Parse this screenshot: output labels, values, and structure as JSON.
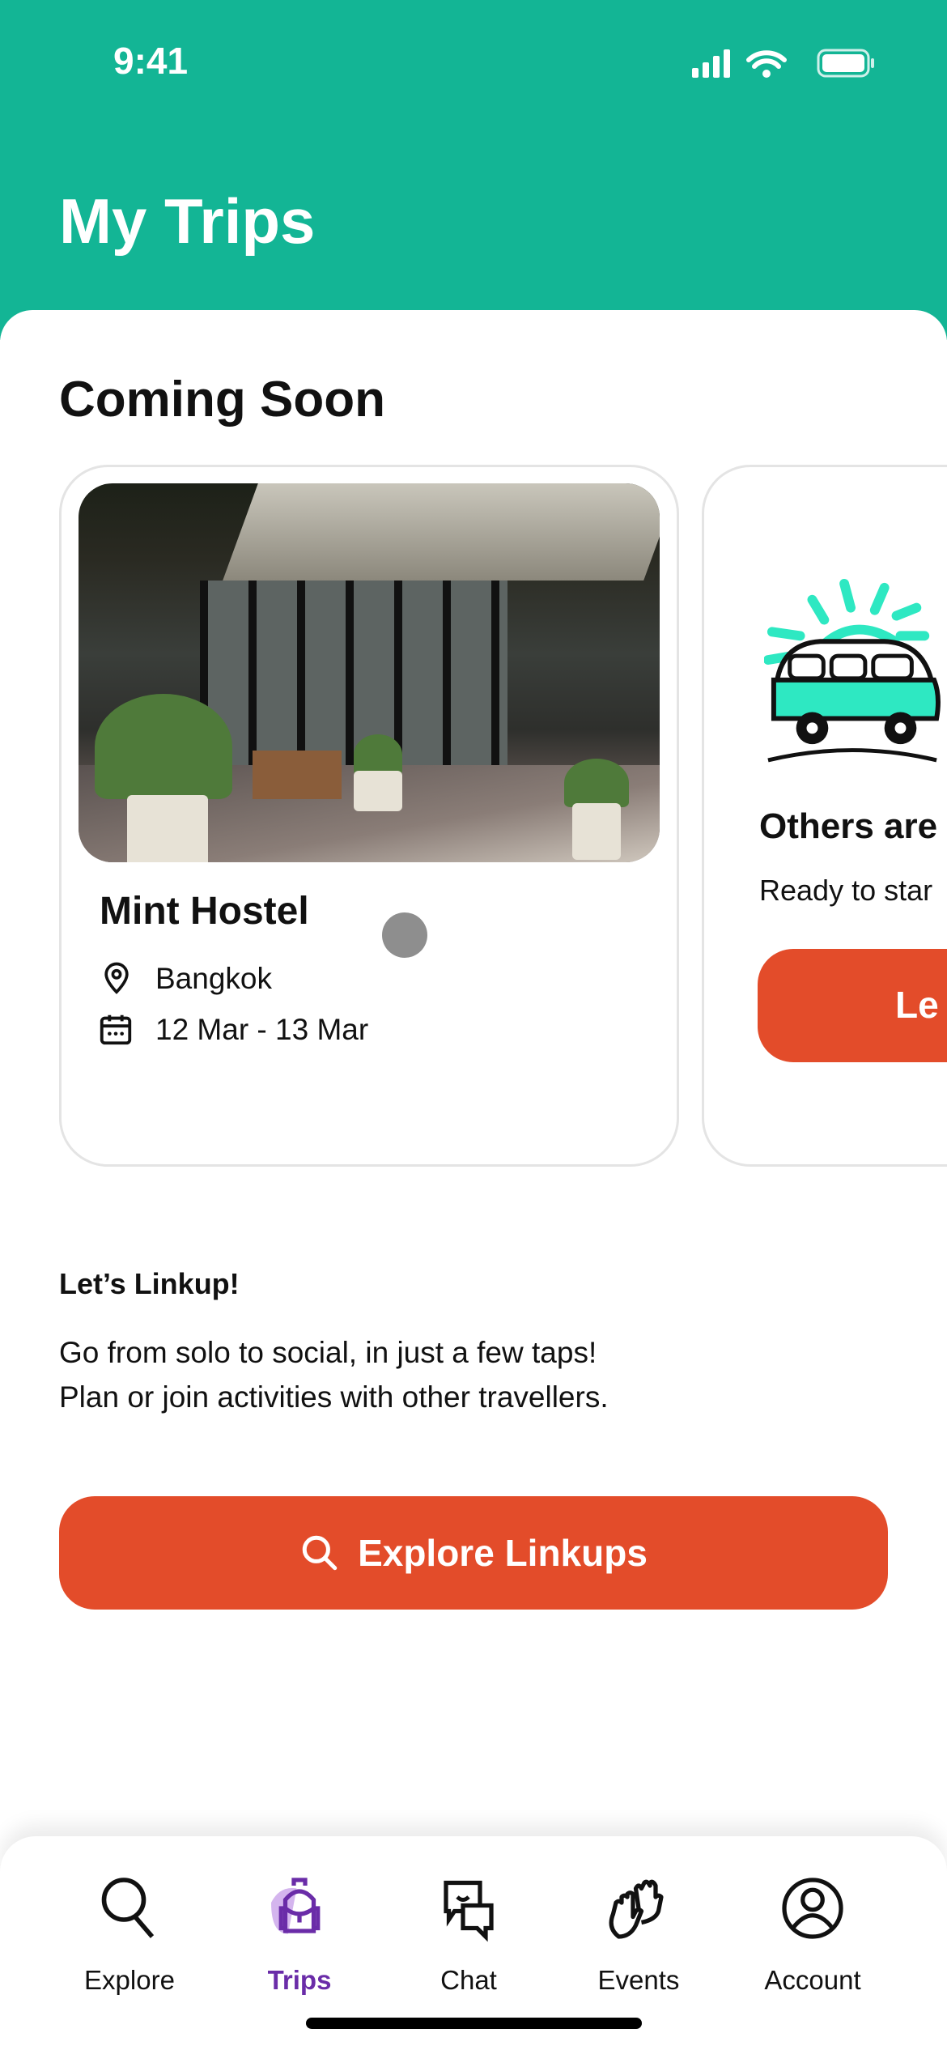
{
  "status_bar": {
    "time": "9:41"
  },
  "header": {
    "title": "My Trips",
    "color": "#13B595"
  },
  "section_title": "Coming Soon",
  "trip_card": {
    "name": "Mint Hostel",
    "location": "Bangkok",
    "dates": "12 Mar - 13 Mar",
    "location_icon": "map-pin-icon",
    "date_icon": "calendar-icon"
  },
  "others_card": {
    "title": "Others are",
    "subtitle": "Ready to star",
    "button_label": "Le"
  },
  "linkup": {
    "heading": "Let’s Linkup!",
    "lines": [
      "Go from solo to social, in just a few taps!",
      "Plan or join activities with other travellers."
    ],
    "button_label": "Explore Linkups",
    "button_color": "#E34C2A"
  },
  "tabs": [
    {
      "label": "Explore",
      "icon": "search-icon"
    },
    {
      "label": "Trips",
      "icon": "backpack-icon",
      "active": true
    },
    {
      "label": "Chat",
      "icon": "chat-icon"
    },
    {
      "label": "Events",
      "icon": "high-five-icon"
    },
    {
      "label": "Account",
      "icon": "account-icon"
    }
  ],
  "accent_color": "#6A2CA8"
}
